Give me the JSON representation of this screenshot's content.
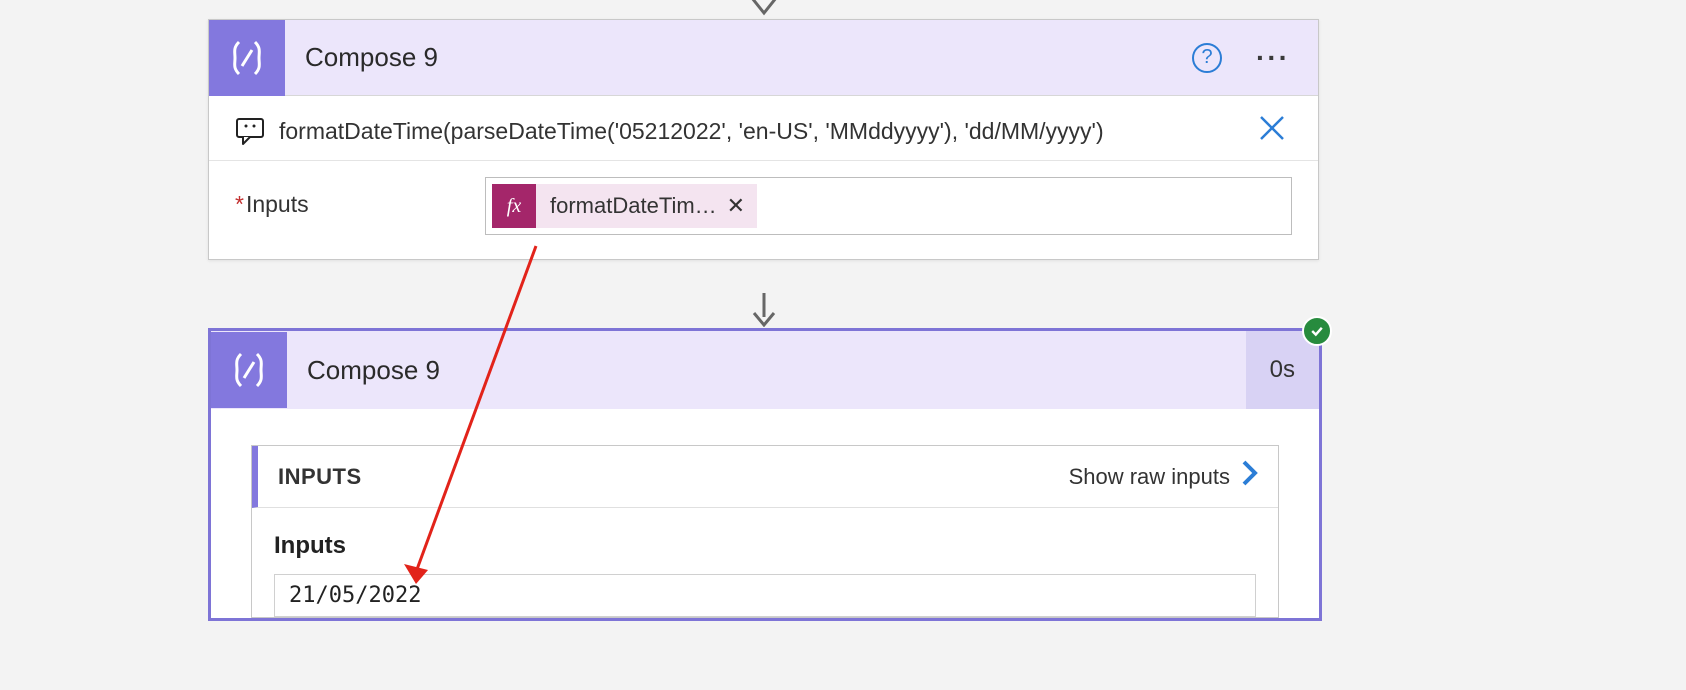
{
  "card1": {
    "title": "Compose 9",
    "comment": "formatDateTime(parseDateTime('05212022', 'en-US', 'MMddyyyy'), 'dd/MM/yyyy')",
    "inputs_label": "Inputs",
    "token_fx": "fx",
    "token_label": "formatDateTim…"
  },
  "card2": {
    "title": "Compose 9",
    "duration": "0s",
    "section_title": "INPUTS",
    "show_raw_label": "Show raw inputs",
    "body_label": "Inputs",
    "value": "21/05/2022"
  },
  "icons": {
    "help": "?",
    "ellipsis": "···"
  }
}
